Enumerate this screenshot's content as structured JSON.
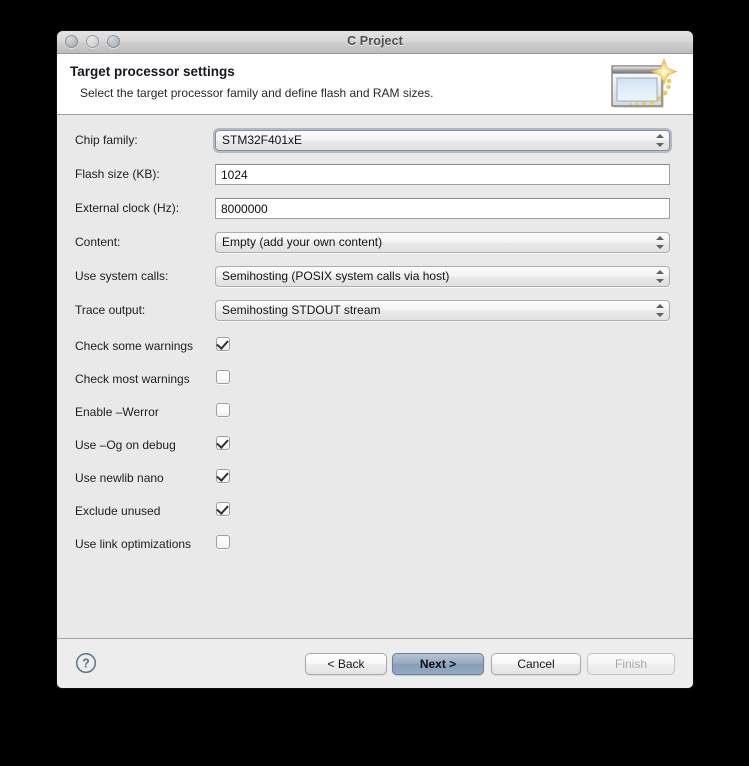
{
  "window": {
    "title": "C Project",
    "traffic_lights": [
      "close-button",
      "minimize-button",
      "zoom-button"
    ]
  },
  "banner": {
    "title": "Target processor settings",
    "subtitle": "Select the target processor family and define flash and RAM sizes.",
    "icon": "wizard-window-sparkle-icon"
  },
  "form": {
    "fields": [
      {
        "label": "Chip family:",
        "type": "combo",
        "value": "STM32F401xE",
        "focused": true
      },
      {
        "label": "Flash size (KB):",
        "type": "text",
        "value": "1024",
        "focused": false
      },
      {
        "label": "External clock (Hz):",
        "type": "text",
        "value": "8000000",
        "focused": false
      },
      {
        "label": "Content:",
        "type": "combo",
        "value": "Empty (add your own content)",
        "focused": false
      },
      {
        "label": "Use system calls:",
        "type": "combo",
        "value": "Semihosting (POSIX system calls via host)",
        "focused": false
      },
      {
        "label": "Trace output:",
        "type": "combo",
        "value": "Semihosting STDOUT stream",
        "focused": false
      }
    ],
    "checkboxes": [
      {
        "label": "Check some warnings",
        "checked": true
      },
      {
        "label": "Check most warnings",
        "checked": false
      },
      {
        "label": "Enable –Werror",
        "checked": false
      },
      {
        "label": "Use –Og on debug",
        "checked": true
      },
      {
        "label": "Use newlib nano",
        "checked": true
      },
      {
        "label": "Exclude unused",
        "checked": true
      },
      {
        "label": "Use link optimizations",
        "checked": false
      }
    ]
  },
  "buttons": {
    "help": "help-icon",
    "back": "< Back",
    "next": "Next >",
    "cancel": "Cancel",
    "finish": "Finish"
  },
  "colors": {
    "window_bg": "#ededed",
    "content_bg": "#e9e9e9",
    "banner_bg": "#ffffff",
    "default_button": "#98abc2",
    "text": "#1b1d21",
    "disabled_text": "#a7a7a7"
  }
}
